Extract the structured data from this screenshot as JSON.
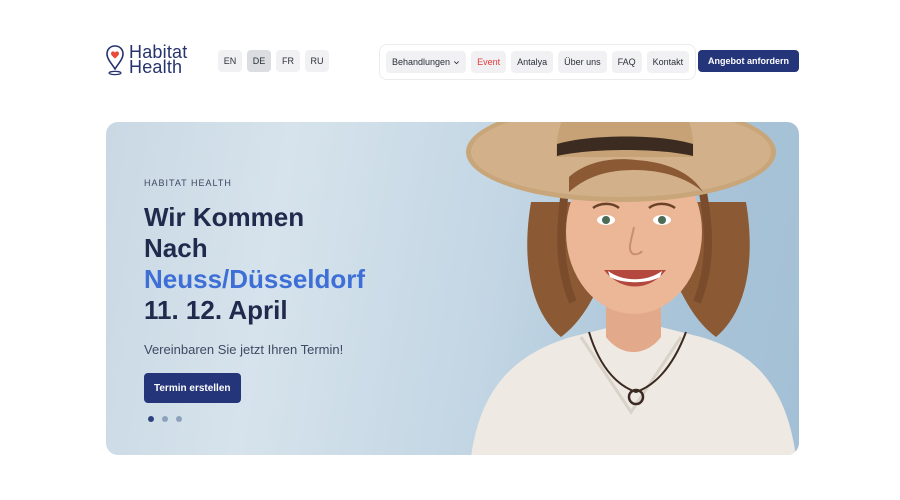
{
  "brand": {
    "line1": "Habitat",
    "line2": "Health"
  },
  "languages": [
    {
      "code": "EN",
      "active": false
    },
    {
      "code": "DE",
      "active": true
    },
    {
      "code": "FR",
      "active": false
    },
    {
      "code": "RU",
      "active": false
    }
  ],
  "nav": {
    "items": [
      "Behandlungen",
      "Event",
      "Antalya",
      "Über uns",
      "FAQ",
      "Kontakt"
    ]
  },
  "header_cta": "Angebot anfordern",
  "hero": {
    "eyebrow": "HABITAT HEALTH",
    "headline_line1": "Wir Kommen",
    "headline_line2": "Nach",
    "headline_accent": "Neuss/Düsseldorf",
    "headline_line4": "11. 12. April",
    "subline": "Vereinbaren Sie jetzt Ihren Termin!",
    "button": "Termin erstellen",
    "slides": 3,
    "active_slide": 1
  },
  "colors": {
    "primary": "#24357a",
    "accent": "#3e6fd6",
    "event_red": "#e23b3b",
    "logo_heart": "#e84b3c"
  }
}
